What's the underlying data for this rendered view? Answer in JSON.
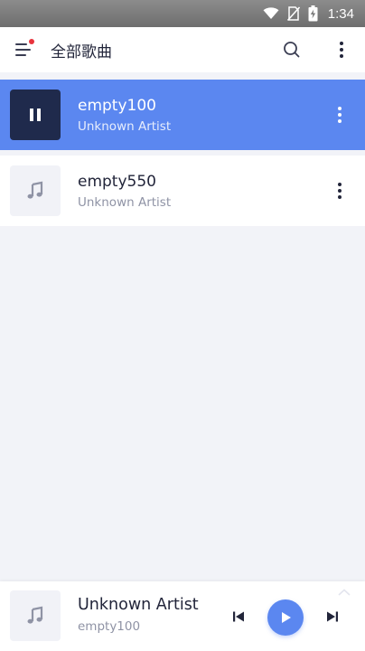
{
  "status_bar": {
    "time": "1:34",
    "icons": [
      "wifi-icon",
      "no-sim-icon",
      "battery-charging-icon"
    ]
  },
  "header": {
    "title": "全部歌曲",
    "menu_icon": "menu-icon",
    "notification_dot_color": "#e8333c",
    "search_icon": "search-icon",
    "more_icon": "more-vertical-icon"
  },
  "songs": [
    {
      "title": "empty100",
      "artist": "Unknown Artist",
      "playing": true,
      "thumb_icon": "pause-icon"
    },
    {
      "title": "empty550",
      "artist": "Unknown Artist",
      "playing": false,
      "thumb_icon": "music-note-icon"
    }
  ],
  "player": {
    "title": "Unknown Artist",
    "subtitle": "empty100",
    "thumb_icon": "music-note-icon",
    "controls": [
      "previous-icon",
      "play-icon",
      "next-icon"
    ]
  },
  "colors": {
    "accent": "#5b87f0",
    "active_thumb": "#1f2a4c",
    "background": "#f2f3f8",
    "text_primary": "#22253a",
    "text_secondary": "#8f93a5"
  }
}
